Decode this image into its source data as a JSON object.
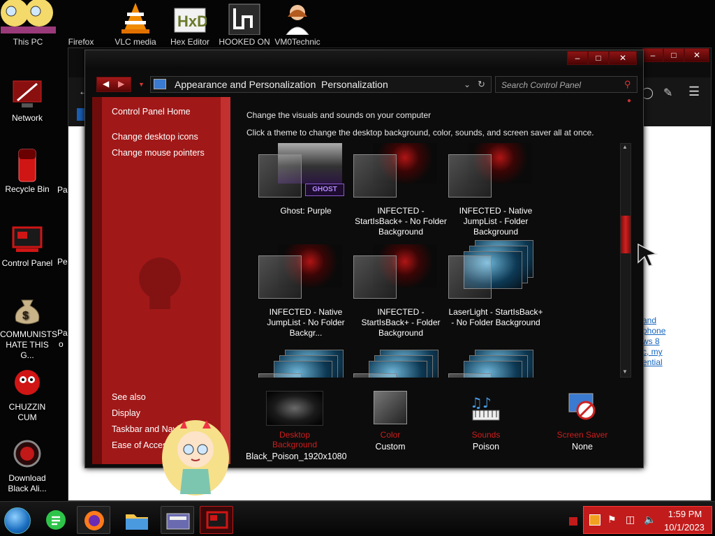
{
  "desktop": {
    "top_icons": [
      {
        "label": "This PC",
        "icon": "this-pc-icon"
      },
      {
        "label": "Firefox",
        "icon": "firefox-icon"
      },
      {
        "label": "VLC media",
        "icon": "vlc-icon"
      },
      {
        "label": "Hex Editor",
        "icon": "hex-editor-icon"
      },
      {
        "label": "HOOKED ON",
        "icon": "hooked-on-icon"
      },
      {
        "label": "VM0Technic",
        "icon": "vm-technician-icon"
      }
    ],
    "left_icons": [
      {
        "label": "Network",
        "icon": "network-icon"
      },
      {
        "label": "Recycle Bin",
        "icon": "recycle-bin-icon"
      },
      {
        "label": "Control Panel",
        "icon": "control-panel-icon"
      },
      {
        "label": "COMMUNISTS HATE THIS G...",
        "icon": "money-bag-icon"
      },
      {
        "label": "CHUZZIN CUM",
        "icon": "red-fuzzball-icon"
      },
      {
        "label": "Download Black Ali...",
        "icon": "download-alien-icon"
      }
    ],
    "second_column_fragments": [
      "Pa",
      "Pe",
      "Pa",
      "o"
    ]
  },
  "browser": {
    "page_links": [
      "and",
      "phone",
      "ws 8",
      "c, my",
      "ential"
    ]
  },
  "window": {
    "breadcrumb": [
      "Appearance and Personalization",
      "Personalization"
    ],
    "search_placeholder": "Search Control Panel",
    "left_nav": {
      "home": "Control Panel Home",
      "links": [
        "Change desktop icons",
        "Change mouse pointers"
      ],
      "see_also_heading": "See also",
      "see_also": [
        "Display",
        "Taskbar and Navi",
        "Ease of Access C"
      ]
    },
    "heading": "Change the visuals and sounds on your computer",
    "subheading": "Click a theme to change the desktop background, color, sounds, and screen saver all at once.",
    "themes": [
      {
        "name": "Ghost: Purple",
        "style": "ghost"
      },
      {
        "name": "INFECTED - StartIsBack+ - No Folder Background",
        "style": "infected"
      },
      {
        "name": "INFECTED - Native JumpList - Folder Background",
        "style": "infected"
      },
      {
        "name": "INFECTED - Native JumpList - No Folder Backgr...",
        "style": "infected"
      },
      {
        "name": "INFECTED - StartIsBack+ - Folder Background",
        "style": "infected"
      },
      {
        "name": "LaserLight - StartIsBack+ - No Folder Background",
        "style": "laser"
      }
    ],
    "bottom": [
      {
        "label": "Desktop Background",
        "value": "Black_Poison_1920x1080",
        "icon": "desktop-background-thumb"
      },
      {
        "label": "Color",
        "value": "Custom",
        "icon": "color-swatch"
      },
      {
        "label": "Sounds",
        "value": "Poison",
        "icon": "sounds-icon"
      },
      {
        "label": "Screen Saver",
        "value": "None",
        "icon": "screen-saver-icon"
      }
    ]
  },
  "taskbar": {
    "time": "1:59 PM",
    "date": "10/1/2023"
  },
  "colors": {
    "accent": "#a11818",
    "label_red": "#d11d1d"
  }
}
